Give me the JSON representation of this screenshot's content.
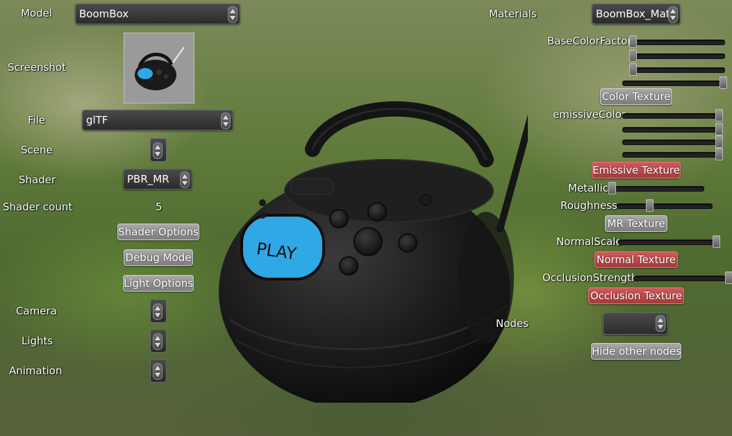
{
  "left_panel": {
    "model": {
      "label": "Model",
      "value": "BoomBox"
    },
    "screenshot": {
      "label": "Screenshot"
    },
    "file": {
      "label": "File",
      "value": "glTF"
    },
    "scene": {
      "label": "Scene"
    },
    "shader": {
      "label": "Shader",
      "value": "PBR_MR"
    },
    "shader_count": {
      "label": "Shader count",
      "value": "5"
    },
    "buttons": {
      "shader_options": "Shader Options",
      "debug_mode": "Debug Mode",
      "light_options": "Light Options"
    },
    "camera": {
      "label": "Camera"
    },
    "lights": {
      "label": "Lights"
    },
    "animation": {
      "label": "Animation"
    }
  },
  "right_panel": {
    "materials": {
      "label": "Materials",
      "value": "BoomBox_Mat"
    },
    "base_color_factor": {
      "label": "BaseColorFactor",
      "levels": [
        0.0,
        0.0,
        0.0,
        1.0
      ]
    },
    "color_texture": "Color Texture",
    "emissive_color": {
      "label": "emissiveColor",
      "levels": [
        1.0,
        1.0,
        1.0,
        1.0
      ]
    },
    "emissive_texture": "Emissive Texture",
    "metallic": {
      "label": "Metallic",
      "level": 0.0
    },
    "roughness": {
      "label": "Roughness",
      "level": 0.33
    },
    "mr_texture": "MR Texture",
    "normal_scale": {
      "label": "NormalScale",
      "level": 1.0
    },
    "normal_texture": "Normal Texture",
    "occlusion_strength": {
      "label": "OcclusionStrength",
      "level": 1.0
    },
    "occlusion_texture": "Occlusion Texture",
    "nodes": {
      "label": "Nodes",
      "value": ""
    },
    "hide_other_nodes": "Hide other nodes"
  },
  "viewport": {
    "model_text": "PLAY",
    "colors": {
      "body": "#1c1c1c",
      "screen": "#2fa8e6",
      "active_button": "#b94a4a"
    }
  }
}
